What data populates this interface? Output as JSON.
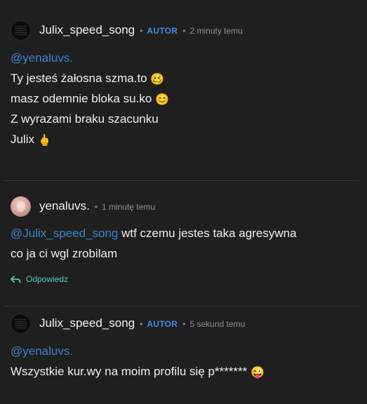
{
  "comments": [
    {
      "username": "Julix_speed_song",
      "badge": "AUTOR",
      "time": "2 minuty temu",
      "mention": "@yenaluvs.",
      "lines": [
        {
          "text": "Ty jesteś żałosna szma.to ",
          "emoji": "🥴"
        },
        {
          "text": "masz odemnie bloka su.ko ",
          "emoji": "😊"
        },
        {
          "text": "Z wyrazami braku szacunku",
          "emoji": ""
        },
        {
          "text": "Julix",
          "emoji": "🖕"
        }
      ]
    },
    {
      "username": "yenaluvs.",
      "time": "1 minutę temu",
      "mention": "@Julix_speed_song",
      "line1_rest": " wtf czemu jestes taka agresywna",
      "line2": "co ja ci wgl zrobilam",
      "reply_label": "Odpowiedz"
    },
    {
      "username": "Julix_speed_song",
      "badge": "AUTOR",
      "time": "5 sekund temu",
      "mention": "@yenaluvs.",
      "line1": "Wszystkie kur.wy na moim profilu się p******* ",
      "line1_emoji": "😜"
    }
  ],
  "separator": "•",
  "icons": {
    "reply": "reply-arrow-icon"
  },
  "colors": {
    "background": "#1f1f1f",
    "author_badge": "#3d8fe0",
    "mention": "#3c82c8",
    "reply": "#4ecdb2"
  }
}
